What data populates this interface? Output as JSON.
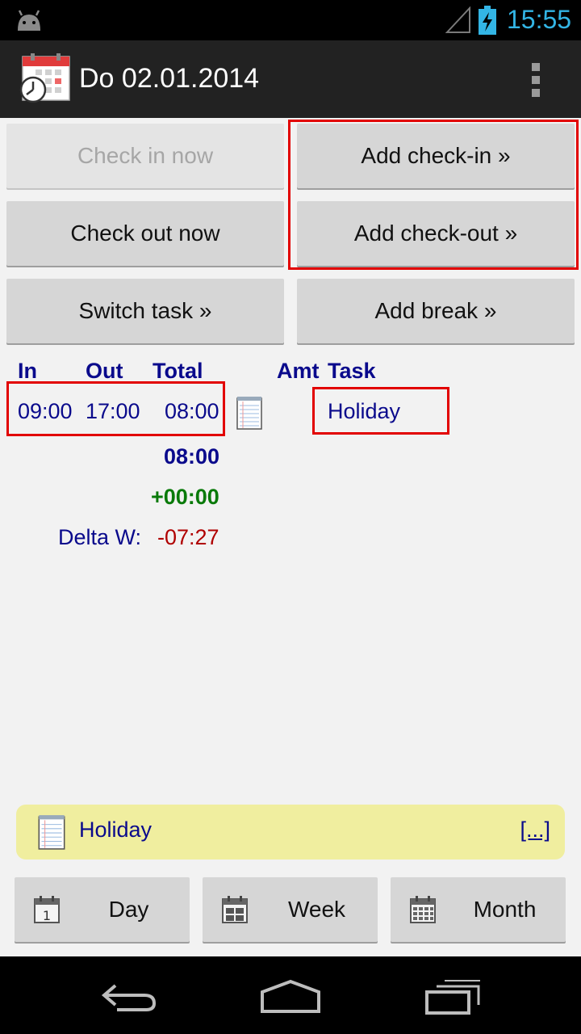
{
  "status_bar": {
    "time": "15:55"
  },
  "action_bar": {
    "title": "Do 02.01.2014"
  },
  "buttons": {
    "check_in_now": "Check in now",
    "add_check_in": "Add check-in »",
    "check_out_now": "Check out now",
    "add_check_out": "Add check-out »",
    "switch_task": "Switch task »",
    "add_break": "Add break »"
  },
  "times_table": {
    "headers": {
      "in": "In",
      "out": "Out",
      "total": "Total",
      "amt": "Amt",
      "task": "Task"
    },
    "rows": [
      {
        "in": "09:00",
        "out": "17:00",
        "total": "08:00",
        "task": "Holiday"
      }
    ]
  },
  "summary": {
    "day_total": "08:00",
    "delta": "+00:00",
    "delta_w_label": "Delta W:",
    "delta_w_value": "-07:27"
  },
  "note": {
    "text": "Holiday",
    "more": "[...]"
  },
  "view_buttons": {
    "day": "Day",
    "week": "Week",
    "month": "Month"
  },
  "colors": {
    "accent_blue": "#33b5e5",
    "text_navy": "#0a0a8c",
    "positive_green": "#0a7a0a",
    "negative_red": "#b00000",
    "highlight_red": "#e20000",
    "note_yellow": "#f0ee9f"
  }
}
